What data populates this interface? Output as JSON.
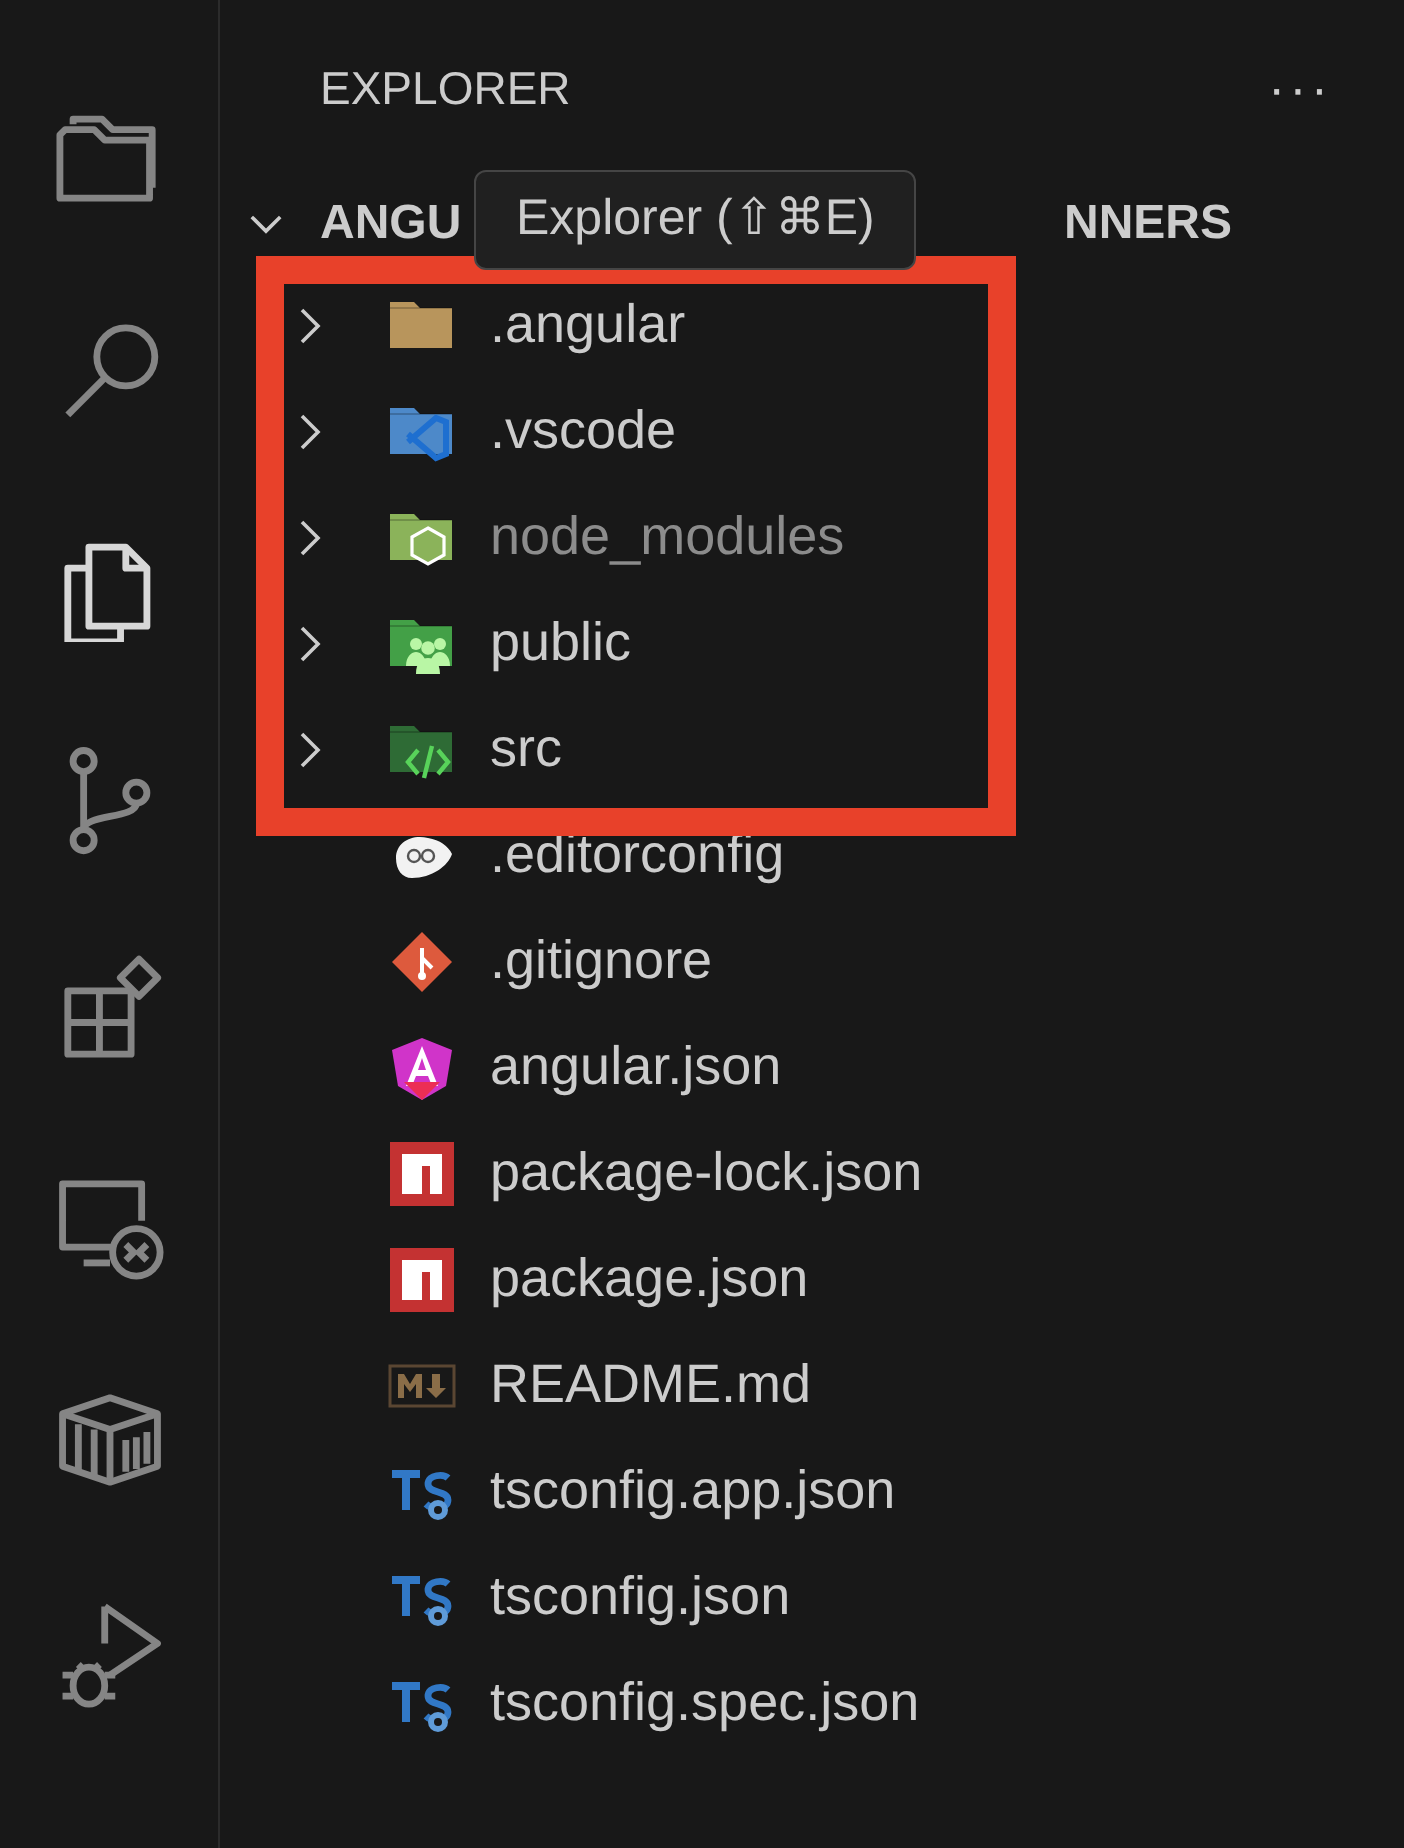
{
  "activity_bar": [
    {
      "kind": "folders",
      "selected": false
    },
    {
      "kind": "search",
      "selected": false
    },
    {
      "kind": "files",
      "selected": true
    },
    {
      "kind": "branch",
      "selected": false
    },
    {
      "kind": "extensions",
      "selected": false
    },
    {
      "kind": "remote",
      "selected": false
    },
    {
      "kind": "container",
      "selected": false
    },
    {
      "kind": "debug",
      "selected": false
    }
  ],
  "sidebar": {
    "title": "EXPLORER",
    "more": "···",
    "section": {
      "title_start": "ANGU",
      "title_end": "NNERS",
      "expanded": true
    },
    "tooltip": "Explorer (⇧⌘E)",
    "highlight": {
      "kind": "annotation-box"
    },
    "items": [
      {
        "name": ".angular",
        "kind": "angular-folder",
        "expanded": false,
        "dimmed": false
      },
      {
        "name": ".vscode",
        "kind": "vscode-folder",
        "expanded": false,
        "dimmed": false
      },
      {
        "name": "node_modules",
        "kind": "node-folder",
        "expanded": false,
        "dimmed": true
      },
      {
        "name": "public",
        "kind": "public-folder",
        "expanded": false,
        "dimmed": false
      },
      {
        "name": "src",
        "kind": "src-folder",
        "expanded": false,
        "dimmed": false
      },
      {
        "name": ".editorconfig",
        "kind": "editorconfig",
        "dimmed": false
      },
      {
        "name": ".gitignore",
        "kind": "git",
        "dimmed": false
      },
      {
        "name": "angular.json",
        "kind": "angular",
        "dimmed": false
      },
      {
        "name": "package-lock.json",
        "kind": "npm",
        "dimmed": false
      },
      {
        "name": "package.json",
        "kind": "npm",
        "dimmed": false
      },
      {
        "name": "README.md",
        "kind": "markdown",
        "dimmed": false
      },
      {
        "name": "tsconfig.app.json",
        "kind": "tsconfig",
        "dimmed": false
      },
      {
        "name": "tsconfig.json",
        "kind": "tsconfig",
        "dimmed": false
      },
      {
        "name": "tsconfig.spec.json",
        "kind": "tsconfig",
        "dimmed": false
      }
    ]
  }
}
